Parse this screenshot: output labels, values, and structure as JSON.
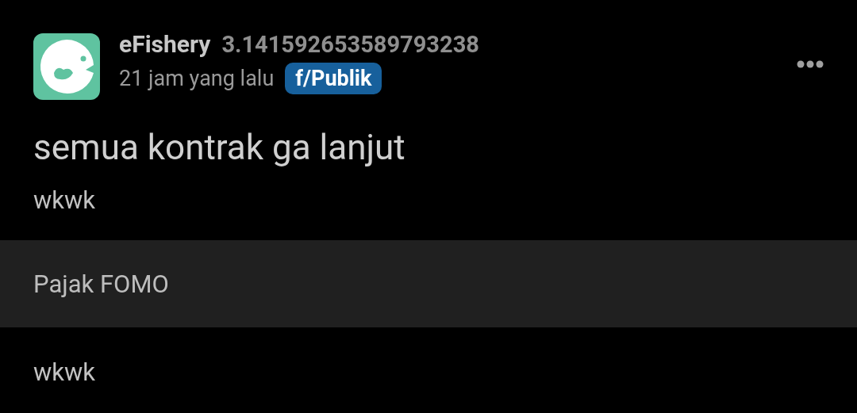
{
  "post": {
    "author": "eFishery",
    "score": "3.141592653589793238",
    "time": "21 jam yang lalu",
    "community": "f/Publik",
    "title": "semua kontrak ga lanjut",
    "body": "wkwk"
  },
  "linked_post": {
    "title": "Pajak FOMO",
    "body": "wkwk"
  }
}
